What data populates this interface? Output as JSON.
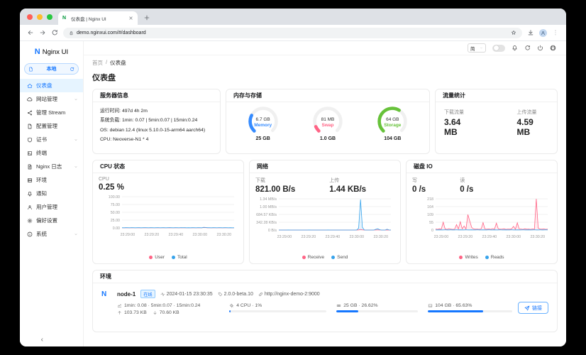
{
  "browser": {
    "tab_title": "仪表盘 | Nginx UI",
    "url": "demo.nginxui.com/#/dashboard"
  },
  "sidebar": {
    "logo_letter": "N",
    "logo_text": "Nginx UI",
    "node_selector": {
      "label": "本地"
    },
    "items": [
      {
        "label": "仪表盘",
        "icon": "home",
        "active": true,
        "expandable": false
      },
      {
        "label": "网站管理",
        "icon": "cloud",
        "active": false,
        "expandable": true
      },
      {
        "label": "管理 Stream",
        "icon": "share",
        "active": false,
        "expandable": false
      },
      {
        "label": "配置管理",
        "icon": "file",
        "active": false,
        "expandable": false
      },
      {
        "label": "证书",
        "icon": "shield",
        "active": false,
        "expandable": true
      },
      {
        "label": "终端",
        "icon": "terminal",
        "active": false,
        "expandable": false
      },
      {
        "label": "Nginx 日志",
        "icon": "logs",
        "active": false,
        "expandable": true
      },
      {
        "label": "环境",
        "icon": "server",
        "active": false,
        "expandable": false
      },
      {
        "label": "通知",
        "icon": "bell",
        "active": false,
        "expandable": false
      },
      {
        "label": "用户管理",
        "icon": "user",
        "active": false,
        "expandable": false
      },
      {
        "label": "偏好设置",
        "icon": "gear",
        "active": false,
        "expandable": false
      },
      {
        "label": "系统",
        "icon": "info",
        "active": false,
        "expandable": true
      }
    ]
  },
  "header": {
    "breadcrumb": [
      "首页",
      "仪表盘"
    ],
    "language": "简"
  },
  "page": {
    "title": "仪表盘"
  },
  "cards": {
    "server_info": {
      "title": "服务器信息",
      "lines": [
        "运行时间: 497d 4h 2m",
        "系统负载: 1min: 0.07 | 5min:0.07 | 15min:0.24",
        "OS: debian 12.4 (linux 5.10.0-15-arm64 aarch64)",
        "CPU: Neoverse-N1 * 4"
      ]
    },
    "memory_storage": {
      "title": "内存与存储",
      "gauges": [
        {
          "name": "memory",
          "value": "6.7 GB",
          "label": "Memory",
          "total": "25 GB",
          "percent": 27,
          "color": "#358bff"
        },
        {
          "name": "swap",
          "value": "81 MB",
          "label": "Swap",
          "total": "1.0 GB",
          "percent": 8,
          "color": "#ff6385"
        },
        {
          "name": "storage",
          "value": "64 GB",
          "label": "Storage",
          "total": "104 GB",
          "percent": 62,
          "color": "#67c23a"
        }
      ]
    },
    "traffic": {
      "title": "流量统计",
      "stats": [
        {
          "label": "下载流量",
          "value": "3.64 MB"
        },
        {
          "label": "上传流量",
          "value": "4.59 MB"
        }
      ]
    },
    "cpu": {
      "title": "CPU 状态",
      "stats": [
        {
          "label": "CPU",
          "value": "0.25 %"
        }
      ]
    },
    "network": {
      "title": "网络",
      "stats": [
        {
          "label": "下载",
          "value": "821.00 B/s"
        },
        {
          "label": "上传",
          "value": "1.44 KB/s"
        }
      ]
    },
    "disk": {
      "title": "磁盘 IO",
      "stats": [
        {
          "label": "写",
          "value": "0 /s"
        },
        {
          "label": "读",
          "value": "0 /s"
        }
      ]
    }
  },
  "chart_data": [
    {
      "id": "cpu",
      "type": "line",
      "title": "CPU 状态",
      "ylabel": "percent",
      "ymax": 100,
      "yticks": [
        "100.00",
        "75.00",
        "50.00",
        "25.00",
        "0.00"
      ],
      "xticks": [
        "23:29:00",
        "23:29:20",
        "23:29:40",
        "23:30:00",
        "23:30:20"
      ],
      "legend_position": "bottom",
      "series": [
        {
          "name": "User",
          "color": "#ff6385",
          "values": [
            0.3,
            0.2,
            0.4,
            0.3,
            0.2,
            0.5,
            0.3,
            0.2,
            0.3,
            0.4,
            0.2,
            0.3,
            0.5,
            0.3,
            0.2,
            0.4,
            0.3,
            0.2,
            0.3,
            0.5,
            0.2,
            0.3,
            0.4,
            0.2,
            0.3,
            0.6,
            0.3,
            0.2,
            0.4,
            0.3,
            0.2,
            0.5,
            0.3,
            0.4,
            0.2,
            0.3,
            0.2,
            0.4,
            0.3,
            0.2,
            0.5,
            0.3,
            0.2,
            1.2,
            0.8,
            0.4,
            0.3,
            0.2,
            0.4,
            0.3,
            0.2,
            0.5,
            0.3,
            0.2,
            0.4,
            0.3,
            0.2,
            0.3,
            0.25,
            0.25
          ]
        },
        {
          "name": "Total",
          "color": "#36a3eb",
          "values": [
            0.6,
            0.5,
            0.7,
            0.6,
            0.5,
            0.8,
            0.6,
            0.5,
            0.6,
            0.7,
            0.5,
            0.6,
            0.8,
            0.6,
            0.5,
            0.7,
            0.6,
            0.5,
            0.6,
            0.8,
            0.5,
            0.6,
            0.7,
            0.5,
            0.6,
            0.9,
            0.6,
            0.5,
            0.7,
            0.6,
            0.5,
            0.8,
            0.6,
            0.7,
            0.5,
            0.6,
            0.5,
            0.7,
            0.6,
            0.5,
            0.8,
            0.6,
            0.5,
            2.0,
            1.3,
            0.7,
            0.6,
            0.5,
            0.7,
            0.6,
            0.5,
            0.8,
            0.6,
            0.5,
            0.7,
            0.6,
            0.5,
            0.6,
            0.5,
            0.5
          ]
        }
      ]
    },
    {
      "id": "network",
      "type": "line",
      "title": "网络",
      "ylabel": "KB/s",
      "ymax": 1369.14,
      "yticks": [
        "1.34 MB/s",
        "1.00 MB/s",
        "684.57 KB/s",
        "342.28 KB/s",
        "0 B/s"
      ],
      "xticks": [
        "23:29:00",
        "23:29:20",
        "23:29:40",
        "23:30:00",
        "23:30:20"
      ],
      "legend_position": "bottom",
      "series": [
        {
          "name": "Receive",
          "color": "#ff6385",
          "values": [
            0.8,
            0.6,
            0.9,
            0.7,
            0.6,
            1.0,
            0.7,
            0.6,
            0.8,
            0.7,
            0.6,
            0.9,
            0.7,
            0.8,
            0.6,
            0.7,
            1.1,
            0.7,
            0.6,
            0.8,
            0.7,
            0.6,
            0.9,
            0.7,
            0.6,
            0.8,
            1.0,
            0.7,
            0.6,
            0.8,
            0.7,
            0.9,
            0.6,
            0.7,
            0.8,
            0.6,
            0.7,
            0.9,
            0.7,
            0.6,
            0.8,
            0.7,
            5.0,
            25.0,
            8.0,
            0.9,
            0.7,
            0.6,
            0.8,
            0.7,
            0.6,
            3.0,
            4.0,
            2.0,
            0.8,
            0.7,
            0.6,
            2.5,
            0.8,
            0.8
          ]
        },
        {
          "name": "Send",
          "color": "#36a3eb",
          "values": [
            1.4,
            1.2,
            1.5,
            1.3,
            1.2,
            1.6,
            1.3,
            1.2,
            1.4,
            1.3,
            1.2,
            1.5,
            1.3,
            1.4,
            1.2,
            1.3,
            1.7,
            1.3,
            1.2,
            1.4,
            1.3,
            1.2,
            1.5,
            1.3,
            1.2,
            1.4,
            1.6,
            1.3,
            1.2,
            1.4,
            1.3,
            1.5,
            1.2,
            1.3,
            1.4,
            1.2,
            1.3,
            1.5,
            1.3,
            1.2,
            1.4,
            6.0,
            80.0,
            1340.0,
            120.0,
            3.0,
            1.4,
            1.2,
            1.4,
            1.3,
            1.2,
            30.0,
            55.0,
            18.0,
            1.4,
            1.3,
            1.2,
            38.0,
            2.0,
            1.4
          ]
        }
      ]
    },
    {
      "id": "disk",
      "type": "line",
      "title": "磁盘 IO",
      "ylabel": "ops",
      "ymax": 218,
      "yticks": [
        "218",
        "164",
        "109",
        "55",
        "0"
      ],
      "xticks": [
        "23:29:00",
        "23:29:20",
        "23:29:40",
        "23:30:00",
        "23:30:20"
      ],
      "legend_position": "bottom",
      "series": [
        {
          "name": "Writes",
          "color": "#ff6385",
          "values": [
            8,
            5,
            9,
            6,
            55,
            8,
            5,
            10,
            7,
            5,
            6,
            38,
            7,
            58,
            9,
            28,
            7,
            108,
            62,
            18,
            8,
            6,
            7,
            5,
            9,
            52,
            7,
            6,
            8,
            5,
            10,
            7,
            48,
            8,
            6,
            7,
            9,
            5,
            7,
            6,
            8,
            26,
            6,
            50,
            8,
            7,
            5,
            9,
            6,
            7,
            5,
            8,
            6,
            218,
            14,
            7,
            6,
            8,
            5,
            7
          ]
        },
        {
          "name": "Reads",
          "color": "#36a3eb",
          "values": [
            1,
            1,
            1.5,
            1,
            1,
            2,
            1,
            1,
            1.5,
            1,
            1,
            2,
            1,
            1.5,
            1,
            1,
            2,
            1,
            1,
            1.5,
            1,
            1,
            2,
            1,
            1,
            1.5,
            1,
            1,
            2,
            1,
            1,
            1.5,
            1,
            1,
            2,
            1,
            1,
            1.5,
            1,
            1,
            2,
            1,
            1,
            1.5,
            1,
            1,
            2,
            1,
            1,
            1.5,
            1,
            1,
            2,
            1,
            1,
            1.5,
            1,
            1,
            2,
            1
          ]
        }
      ]
    }
  ],
  "environment": {
    "title": "环境",
    "node": {
      "avatar": "N",
      "name": "node-1",
      "status": "在线",
      "updated_at": "2024-01-15 23:30:35",
      "version": "2.0.0-beta.10",
      "url": "http://nginx-demo-2:9000",
      "load": "1min: 0.08 · 5min:0.07 · 15min:0.24",
      "net_upload": "103.73 KB",
      "net_download": "70.60 KB",
      "cpu": {
        "label": "4 CPU · 1%",
        "percent": 1
      },
      "memory": {
        "label": "25 GB · 26.62%",
        "percent": 26.62
      },
      "storage": {
        "label": "104 GB · 65.63%",
        "percent": 65.63
      },
      "link_button": "链接"
    }
  },
  "colors": {
    "primary": "#1677ff",
    "series_a": "#ff6385",
    "series_b": "#36a3eb",
    "gauge_memory": "#358bff",
    "gauge_swap": "#ff6385",
    "gauge_storage": "#67c23a"
  }
}
